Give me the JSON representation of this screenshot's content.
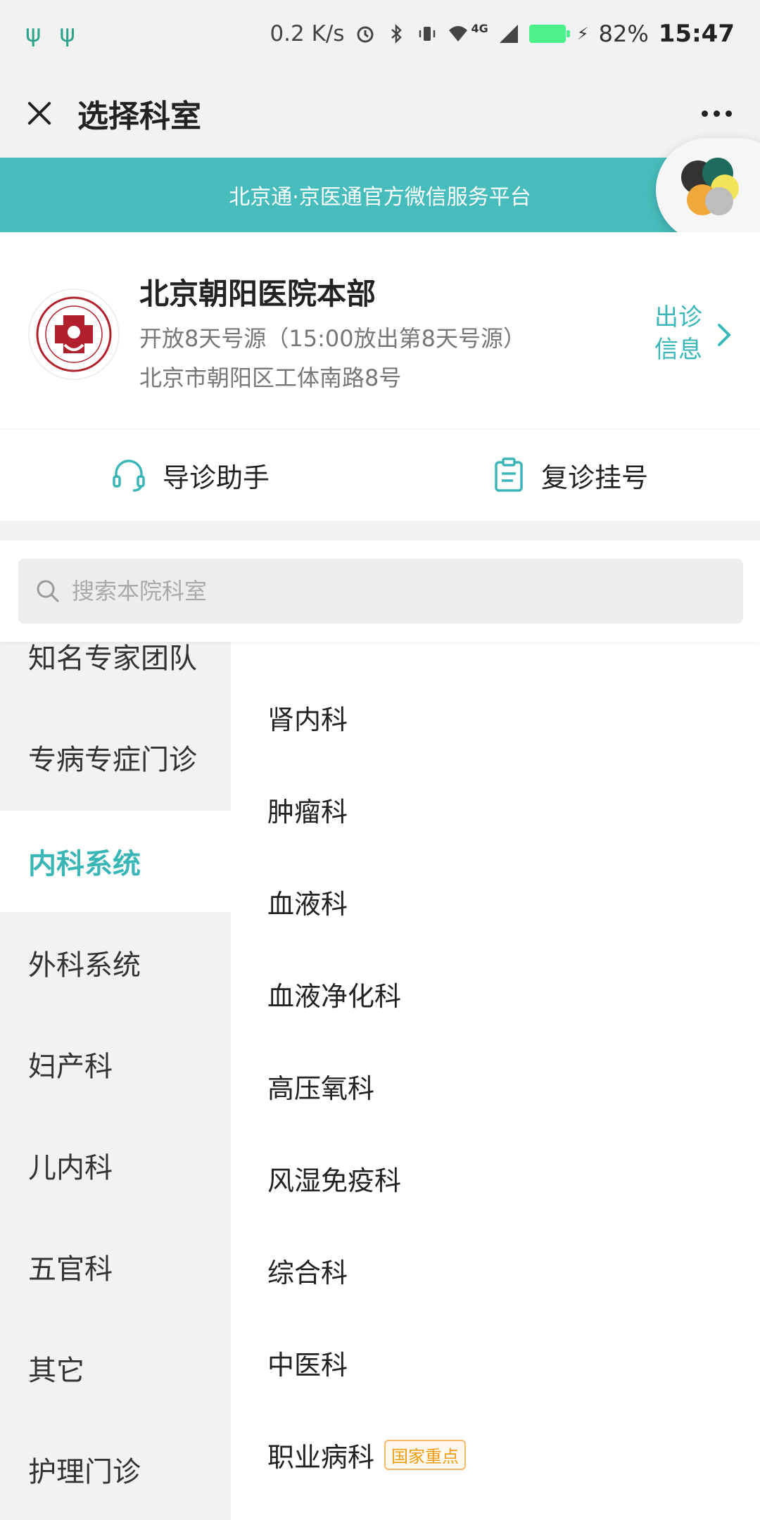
{
  "status_bar": {
    "speed": "0.2 K/s",
    "network": "4G",
    "battery": "82%",
    "time": "15:47"
  },
  "title_bar": {
    "title": "选择科室"
  },
  "banner": {
    "text": "北京通·京医通官方微信服务平台"
  },
  "hospital": {
    "name": "北京朝阳医院本部",
    "open_info": "开放8天号源（15:00放出第8天号源）",
    "address": "北京市朝阳区工体南路8号",
    "clinic_info_line1": "出诊",
    "clinic_info_line2": "信息"
  },
  "tools": {
    "guide": "导诊助手",
    "revisit": "复诊挂号"
  },
  "search": {
    "placeholder": "搜索本院科室"
  },
  "categories": [
    {
      "label": "知名专家团队"
    },
    {
      "label": "专病专症门诊"
    },
    {
      "label": "内科系统"
    },
    {
      "label": "外科系统"
    },
    {
      "label": "妇产科"
    },
    {
      "label": "儿内科"
    },
    {
      "label": "五官科"
    },
    {
      "label": "其它"
    },
    {
      "label": "护理门诊"
    }
  ],
  "departments": [
    {
      "label": "肾内科"
    },
    {
      "label": "肿瘤科"
    },
    {
      "label": "血液科"
    },
    {
      "label": "血液净化科"
    },
    {
      "label": "高压氧科"
    },
    {
      "label": "风湿免疫科"
    },
    {
      "label": "综合科"
    },
    {
      "label": "中医科"
    },
    {
      "label": "职业病科",
      "badge": "国家重点"
    }
  ],
  "colors": {
    "accent": "#3bb6b6",
    "banner": "#47bcbc",
    "badge": "#f39c12"
  }
}
